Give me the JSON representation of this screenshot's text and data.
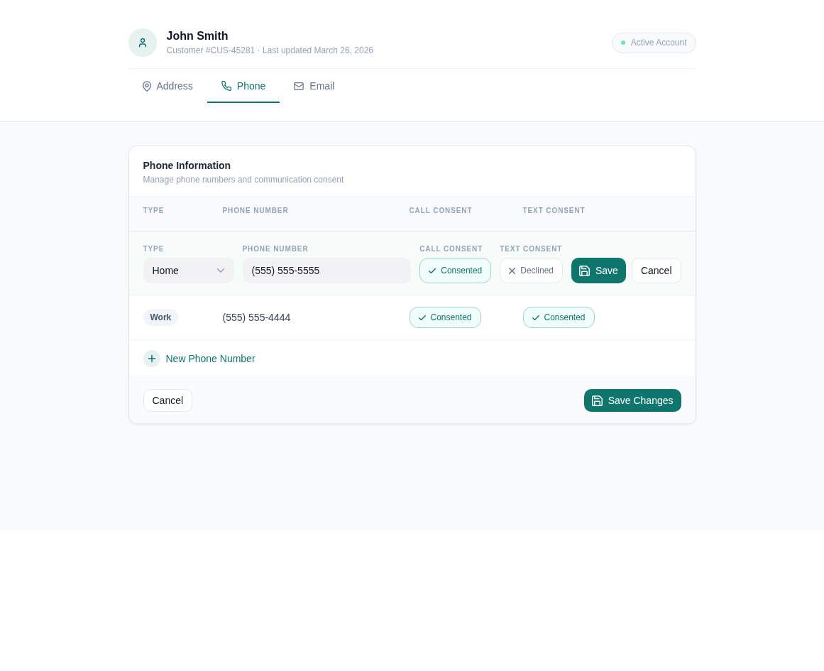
{
  "customer": {
    "name": "John Smith",
    "subtitle": "Customer #CUS-45281 · Last updated March 26, 2026",
    "status": {
      "label": "Active Account",
      "active": true
    }
  },
  "tabs": [
    {
      "kind": "address",
      "label": "Address",
      "selected": false
    },
    {
      "kind": "phone",
      "label": "Phone",
      "selected": true
    },
    {
      "kind": "email",
      "label": "Email",
      "selected": false
    }
  ],
  "card": {
    "title": "Phone Information",
    "subtitle": "Manage phone numbers and communication consent"
  },
  "table": {
    "columns": [
      "TYPE",
      "PHONE NUMBER",
      "CALL CONSENT",
      "TEXT CONSENT"
    ]
  },
  "edit_row": {
    "type_field": {
      "label": "TYPE",
      "value": "Home"
    },
    "phone_field": {
      "label": "PHONE NUMBER",
      "value": "(555) 555-5555"
    },
    "call_consent": {
      "label": "CALL CONSENT",
      "status": "Consented",
      "consented": true
    },
    "text_consent": {
      "label": "TEXT CONSENT",
      "status": "Declined",
      "consented": false
    },
    "save_button": "Save",
    "cancel_button": "Cancel"
  },
  "rows": [
    {
      "type": "Work",
      "phone": "(555) 555-4444",
      "call_consent": {
        "status": "Consented",
        "consented": true
      },
      "text_consent": {
        "status": "Consented",
        "consented": true
      }
    }
  ],
  "add_button": "New Phone Number",
  "footer": {
    "cancel_button": "Cancel",
    "save_button": "Save Changes"
  }
}
